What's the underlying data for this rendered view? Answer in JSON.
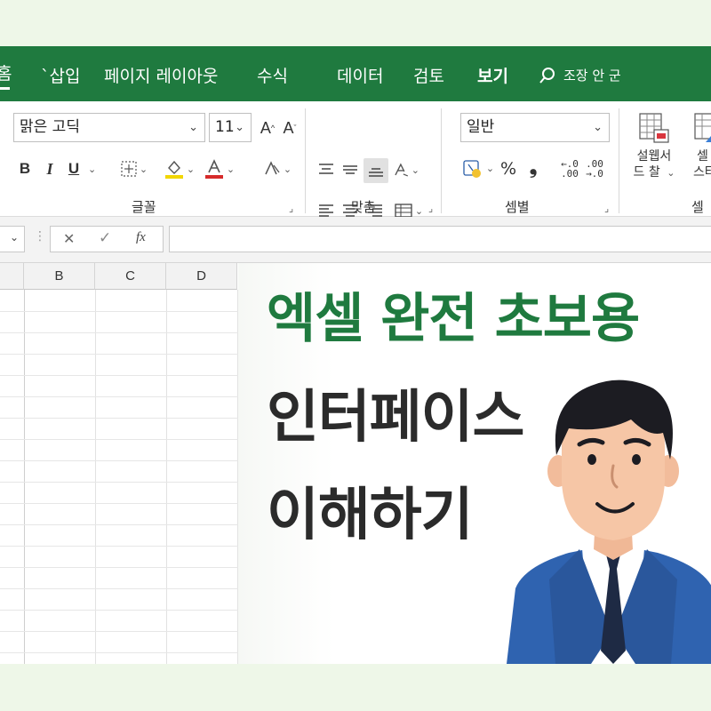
{
  "tabs": {
    "home": "홈",
    "insert": "`삽입",
    "page_layout": "페이지 레이아웃",
    "formulas": "수식",
    "data": "데이터",
    "review": "검토",
    "view": "보기",
    "search_hint": "조장 안 군"
  },
  "ribbon": {
    "font_name": "맑은 고딕",
    "font_size": "11",
    "grow_font": "A",
    "shrink_font": "A",
    "bold": "B",
    "italic": "I",
    "underline": "U",
    "font_group_label": "글꼴",
    "align_group_label": "맞춤",
    "number_format": "일반",
    "percent": "%",
    "comma": "❟",
    "inc_decimal": "←.0\n.00",
    "dec_decimal": ".00\n→.0",
    "number_group_label": "셈별",
    "cond_format_line1": "설웹서",
    "cond_format_line2": "드 찰",
    "cell_styles_line1": "셀",
    "cell_styles_line2": "스타",
    "cells_group_label": "셀"
  },
  "formula_bar": {
    "cancel": "✕",
    "enter": "✓",
    "fx": "fx"
  },
  "columns": [
    "B",
    "C",
    "D"
  ],
  "headline": {
    "line1": "엑셀 완전 초보용",
    "line2": "인터페이스",
    "line3": "이해하기"
  },
  "colors": {
    "excel_green": "#1f7a3f",
    "headline_dark": "#2b2b2b",
    "background": "#eef7e8"
  }
}
